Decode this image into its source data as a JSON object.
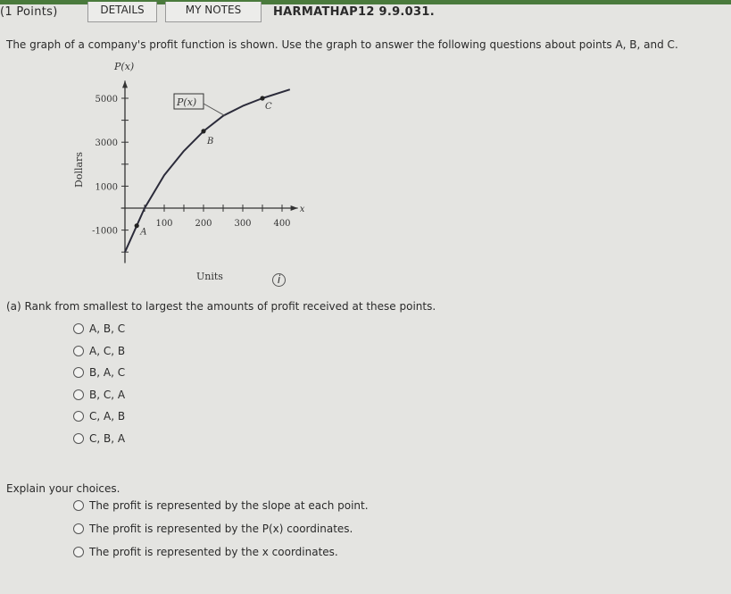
{
  "header": {
    "points": "(1 Points)",
    "details": "DETAILS",
    "notes": "MY NOTES",
    "problem_id": "HARMATHAP12 9.9.031."
  },
  "prompt": "The graph of a company's profit function is shown. Use the graph to answer the following questions about points A, B, and C.",
  "chart_data": {
    "type": "line",
    "xlabel": "Units",
    "ylabel": "Dollars",
    "y_title": "P(x)",
    "x_title": "x",
    "curve_label": "P(x)",
    "x_ticks": [
      100,
      200,
      300,
      400
    ],
    "y_ticks": [
      5000,
      3000,
      1000,
      -1000
    ],
    "xlim": [
      0,
      420
    ],
    "ylim": [
      -2000,
      5500
    ],
    "curve": [
      [
        0,
        -2000
      ],
      [
        25,
        -1000
      ],
      [
        50,
        0
      ],
      [
        100,
        1500
      ],
      [
        150,
        2600
      ],
      [
        200,
        3500
      ],
      [
        250,
        4200
      ],
      [
        300,
        4650
      ],
      [
        350,
        5000
      ],
      [
        420,
        5400
      ]
    ],
    "points": [
      {
        "name": "A",
        "x": 30,
        "y": -800
      },
      {
        "name": "B",
        "x": 200,
        "y": 3500
      },
      {
        "name": "C",
        "x": 350,
        "y": 5000
      }
    ]
  },
  "part_a": {
    "question": "(a) Rank from smallest to largest the amounts of profit received at these points.",
    "options": [
      "A, B, C",
      "A, C, B",
      "B, A, C",
      "B, C, A",
      "C, A, B",
      "C, B, A"
    ]
  },
  "explain": {
    "label": "Explain your choices.",
    "options": [
      "The profit is represented by the slope at each point.",
      "The profit is represented by the P(x) coordinates.",
      "The profit is represented by the x coordinates."
    ]
  },
  "info_icon": "info-icon"
}
